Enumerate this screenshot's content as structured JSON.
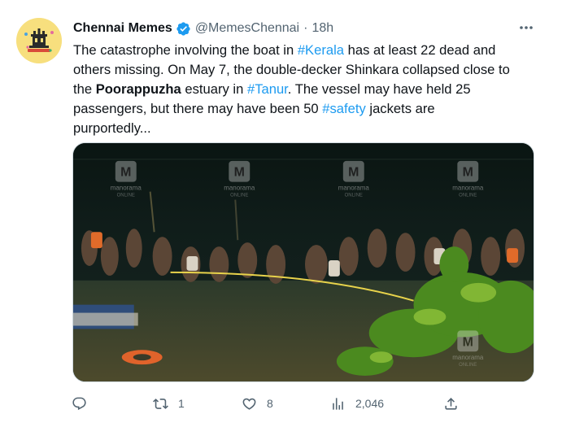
{
  "author": {
    "name": "Chennai Memes",
    "handle": "@MemesChennai",
    "separator": "·",
    "time": "18h",
    "avatar_icon": "chennai-memes-logo",
    "verified_color": "#1d9bf0"
  },
  "tweet": {
    "segments": [
      {
        "text": "The catastrophe involving the boat in ",
        "style": "plain"
      },
      {
        "text": "#Kerala",
        "style": "hashtag"
      },
      {
        "text": " has at least 22 dead and\nothers missing. On May 7, the double-decker Shinkara collapsed close to\nthe ",
        "style": "plain"
      },
      {
        "text": "Poorappuzha",
        "style": "bold"
      },
      {
        "text": " estuary in ",
        "style": "plain"
      },
      {
        "text": "#Tanur",
        "style": "hashtag"
      },
      {
        "text": ". The vessel may have held 25\npassengers, but there may have been 50 ",
        "style": "plain"
      },
      {
        "text": "#safety",
        "style": "hashtag"
      },
      {
        "text": " jackets are\npurportedly...",
        "style": "plain"
      }
    ],
    "link_color": "#1d9bf0"
  },
  "media": {
    "watermark": "manorama",
    "watermark_sub": "ONLINE",
    "watermark_logo": "M",
    "description_icon": "rescue-scene-photo"
  },
  "actions": {
    "reply": {
      "icon": "reply-icon",
      "count": ""
    },
    "retweet": {
      "icon": "retweet-icon",
      "count": "1"
    },
    "like": {
      "icon": "heart-icon",
      "count": "8"
    },
    "views": {
      "icon": "views-icon",
      "count": "2,046"
    },
    "share": {
      "icon": "share-icon",
      "count": ""
    }
  },
  "colors": {
    "text_primary": "#0f1419",
    "text_secondary": "#536471"
  }
}
